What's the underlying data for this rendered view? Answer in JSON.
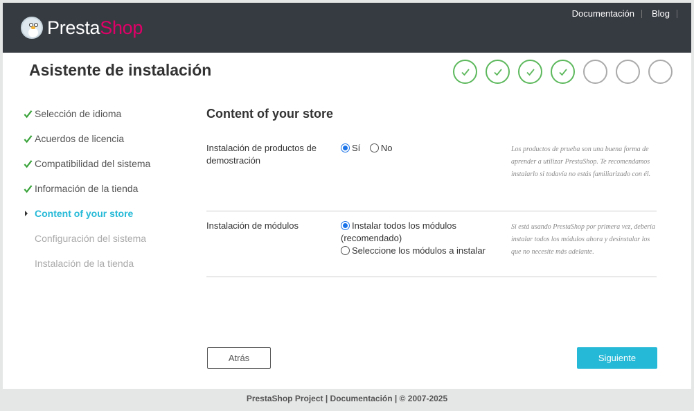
{
  "header": {
    "logo": {
      "part1": "Presta",
      "part2": "Shop"
    },
    "links": [
      "Documentación",
      "Blog"
    ]
  },
  "main": {
    "title": "Asistente de instalación",
    "progress": {
      "total_steps": 7,
      "completed_steps": 4
    }
  },
  "sidebar": {
    "items": [
      {
        "label": "Selección de idioma",
        "state": "done"
      },
      {
        "label": "Acuerdos de licencia",
        "state": "done"
      },
      {
        "label": "Compatibilidad del sistema",
        "state": "done"
      },
      {
        "label": "Información de la tienda",
        "state": "done"
      },
      {
        "label": "Content of your store",
        "state": "current"
      },
      {
        "label": "Configuración del sistema",
        "state": "todo"
      },
      {
        "label": "Instalación de la tienda",
        "state": "todo"
      }
    ]
  },
  "content": {
    "heading": "Content of your store",
    "demo_products": {
      "label": "Instalación de productos de demostración",
      "options": [
        {
          "label": "Sí",
          "checked": true
        },
        {
          "label": "No",
          "checked": false
        }
      ],
      "help": "Los productos de prueba son una buena forma de aprender a utilizar PrestaShop. Te recomendamos instalarlo si todavía no estás familiarizado con él."
    },
    "modules": {
      "label": "Instalación de módulos",
      "options": [
        {
          "label": "Instalar todos los módulos (recomendado)",
          "checked": true
        },
        {
          "label": "Seleccione los módulos a instalar",
          "checked": false
        }
      ],
      "help": "Si está usando PrestaShop por primera vez, debería instalar todos los módulos ahora y desinstalar los que no necesite más adelante."
    }
  },
  "buttons": {
    "back": "Atrás",
    "next": "Siguiente"
  },
  "footer": {
    "text": "PrestaShop Project | Documentación | © 2007-2025"
  },
  "colors": {
    "topbar": "#363a41",
    "accent": "#25b9d7",
    "brand": "#df0067",
    "done": "#5cb85c"
  }
}
